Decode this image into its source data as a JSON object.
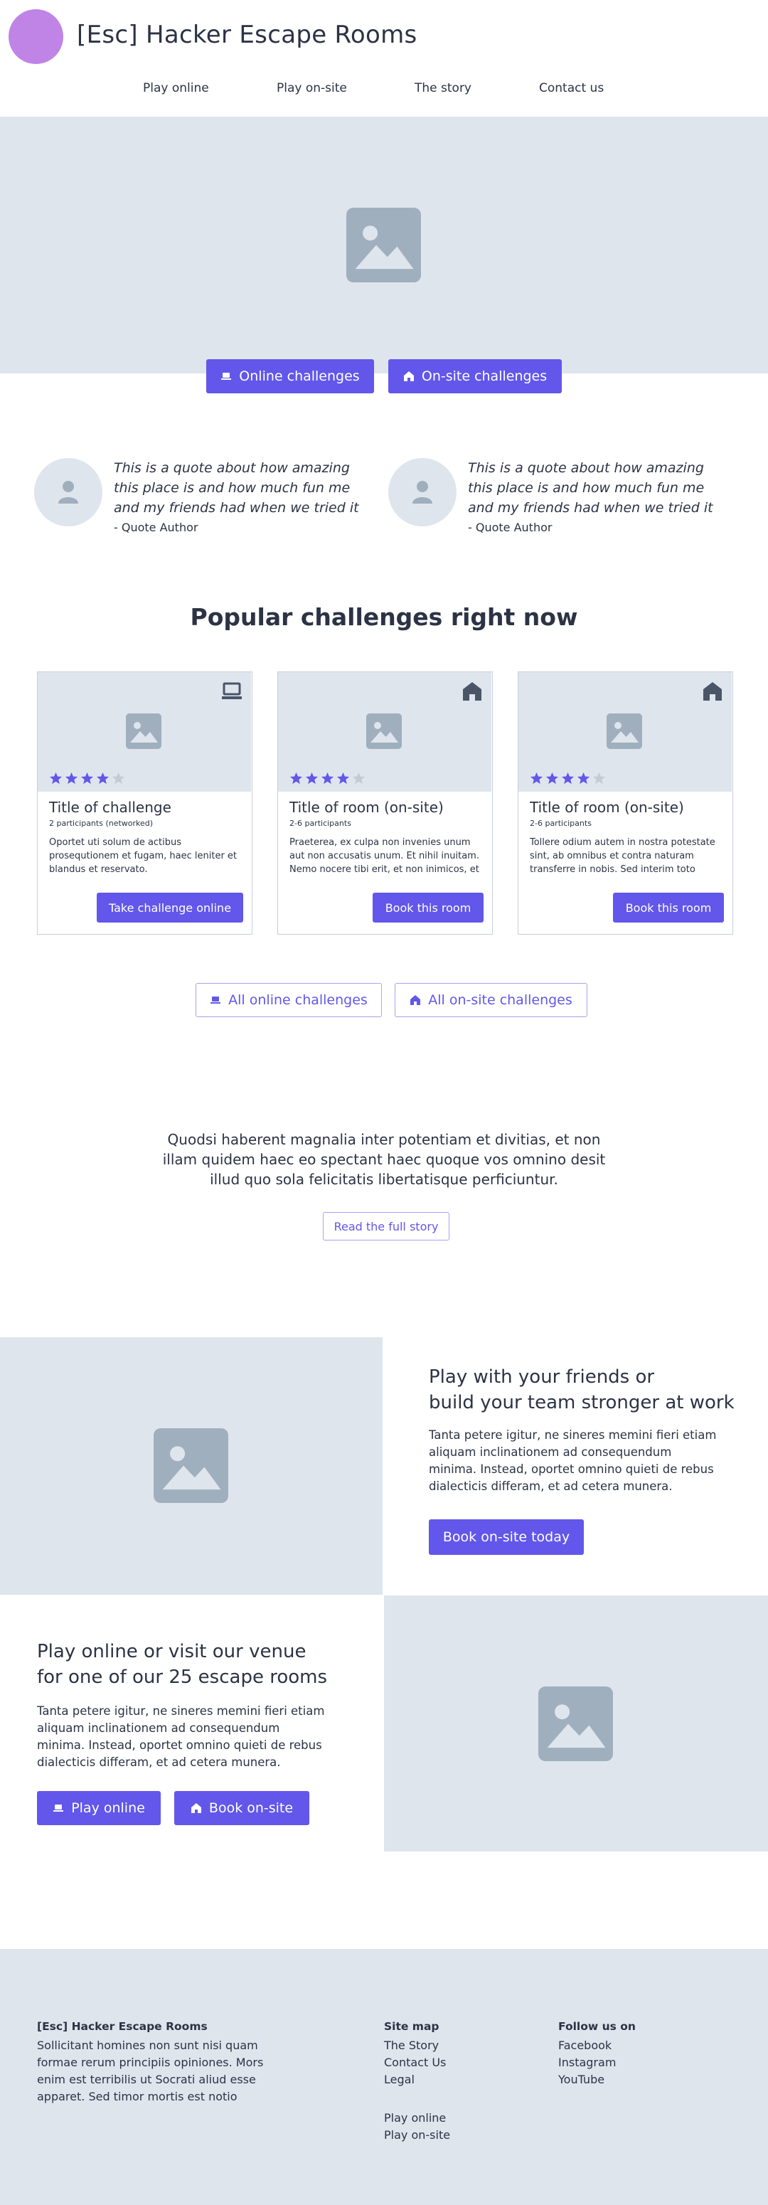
{
  "header": {
    "title": "[Esc] Hacker Escape Rooms",
    "nav": [
      "Play online",
      "Play on-site",
      "The story",
      "Contact us"
    ]
  },
  "hero": {
    "online_button": "Online challenges",
    "onsite_button": "On-site challenges"
  },
  "testimonials": [
    {
      "quote": "This is a quote about how amazing this place is and how much fun me and my friends had when we tried it",
      "author": "- Quote Author"
    },
    {
      "quote": "This is a quote about how amazing this place is and how much fun me and my friends had when we tried it",
      "author": "- Quote Author"
    }
  ],
  "popular": {
    "title": "Popular challenges right now",
    "cards": [
      {
        "type_icon": "laptop-icon",
        "rating": 4,
        "title": "Title of challenge",
        "participants": "2 participants (networked)",
        "description": "Oportet uti solum de actibus prosequtionem et fugam, haec leniter et blandus et reservato.",
        "button": "Take challenge online"
      },
      {
        "type_icon": "house-icon",
        "rating": 4,
        "title": "Title of room (on-site)",
        "participants": "2-6 participants",
        "description": "Praeterea, ex culpa non invenies unum aut non accusatis unum. Et nihil inuitam. Nemo nocere tibi erit, et non inimicos, et",
        "button": "Book this room"
      },
      {
        "type_icon": "house-icon",
        "rating": 4,
        "title": "Title of room (on-site)",
        "participants": "2-6 participants",
        "description": "Tollere odium autem in nostra potestate sint, ab omnibus et contra naturam transferre in nobis. Sed interim toto",
        "button": "Book this room"
      }
    ],
    "all_online_button": "All online challenges",
    "all_onsite_button": "All on-site challenges"
  },
  "story": {
    "text": "Quodsi haberent magnalia inter potentiam et divitias, et non illam quidem haec eo spectant haec quoque vos omnino desit illud quo sola felicitatis libertatisque perficiuntur.",
    "button": "Read the full story"
  },
  "feature1": {
    "title_line1": "Play with your friends or",
    "title_line2": "build your team stronger at work",
    "text": "Tanta petere igitur, ne sineres memini fieri etiam aliquam inclinationem ad consequendum minima. Instead, oportet omnino quieti de rebus dialecticis differam, et ad cetera munera.",
    "button": "Book on-site today"
  },
  "feature2": {
    "title_line1": "Play online or visit our venue",
    "title_line2": "for one of our 25 escape rooms",
    "text": "Tanta petere igitur, ne sineres memini fieri etiam aliquam inclinationem ad consequendum minima. Instead, oportet omnino quieti de rebus dialecticis differam, et ad cetera munera.",
    "online_button": "Play online",
    "onsite_button": "Book on-site"
  },
  "footer": {
    "brand": "[Esc] Hacker Escape Rooms",
    "brand_text": "Sollicitant homines non sunt nisi quam formae rerum principiis opiniones. Mors enim est terribilis ut Socrati aliud esse apparet. Sed timor mortis est notio",
    "sitemap_title": "Site map",
    "sitemap_links": [
      "The Story",
      "Contact Us",
      "Legal"
    ],
    "sitemap_links2": [
      "Play online",
      "Play on-site"
    ],
    "follow_title": "Follow us on",
    "follow_links": [
      "Facebook",
      "Instagram",
      "YouTube"
    ]
  },
  "colors": {
    "accent": "#6257ea",
    "panel": "#dfe5ed",
    "placeholder": "#9fafbe",
    "logo": "#c084e6",
    "star_off": "#c5cad3",
    "text": "#2c3345"
  }
}
